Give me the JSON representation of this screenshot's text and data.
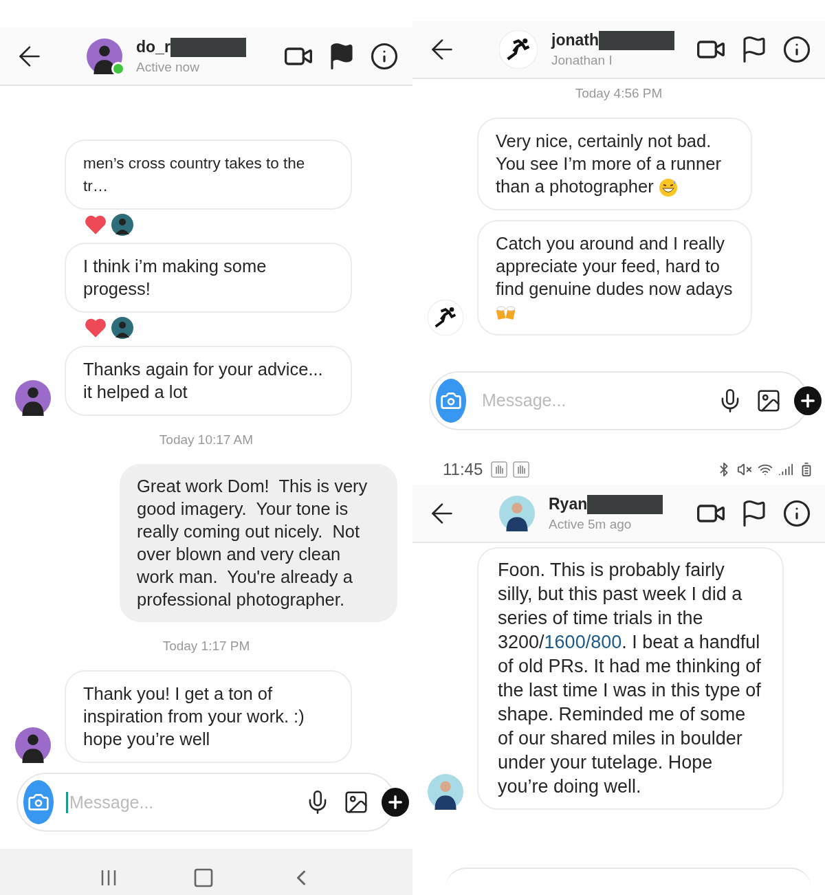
{
  "left_chat": {
    "header": {
      "name": "do_r",
      "status": "Active now",
      "online": true,
      "redacted": true,
      "flagged": true
    },
    "messages": [
      {
        "kind": "received_post",
        "text": "men’s cross country takes to the tr…",
        "avatar": false,
        "reactions": true,
        "emoji": false
      },
      {
        "kind": "received",
        "text": "I think i’m making some progess!",
        "avatar": false,
        "reactions": true,
        "emoji": false
      },
      {
        "kind": "received",
        "text": "Thanks again for your advice... it helped a lot",
        "avatar": true,
        "reactions": false,
        "emoji": false
      },
      {
        "kind": "timestamp",
        "text": "Today 10:17 AM"
      },
      {
        "kind": "sent",
        "text": "Great work Dom!  This is very good imagery.  Your tone is really coming out nicely.  Not over blown and very clean work man.  You're already a professional photographer.",
        "reactions": false,
        "emoji": false
      },
      {
        "kind": "timestamp",
        "text": "Today 1:17 PM"
      },
      {
        "kind": "received",
        "text": "Thank you! I get a ton of inspiration from your work. :) hope you’re well",
        "avatar": true,
        "reactions": false,
        "emoji": false
      }
    ],
    "composer": {
      "placeholder": "Message...",
      "focused": true
    }
  },
  "right_top_chat": {
    "header": {
      "name": "jonath",
      "status": "Jonathan I",
      "online": false,
      "redacted": true,
      "flagged": false
    },
    "messages": [
      {
        "kind": "timestamp",
        "text": "Today 4:56 PM"
      },
      {
        "kind": "received",
        "text": "Very nice, certainly not bad. You see I’m more of a runner than a photographer",
        "avatar": false,
        "reactions": false,
        "emoji": true
      },
      {
        "kind": "received",
        "text": "Catch you around and I really appreciate your feed, hard to find genuine dudes now adays",
        "avatar": true,
        "reactions": false,
        "emoji": true
      }
    ],
    "composer": {
      "placeholder": "Message...",
      "focused": false
    }
  },
  "status_bar": {
    "time": "11:45"
  },
  "right_bottom_chat": {
    "header": {
      "name": "Ryan",
      "status": "Active 5m ago",
      "online": false,
      "redacted": true,
      "flagged": false
    },
    "messages": [
      {
        "kind": "received_segments",
        "avatar": true,
        "segments": [
          {
            "text": "Foon. This is probably fairly silly, but this past week I did a series of time trials in the 3200/",
            "link": false
          },
          {
            "text": "1600/800",
            "link": true
          },
          {
            "text": ". I beat a handful of old PRs. It had me thinking of the last time I was in this type of shape. Reminded me of some of our shared miles in boulder under your tutelage. Hope you’re doing well.",
            "link": false
          }
        ]
      }
    ]
  }
}
